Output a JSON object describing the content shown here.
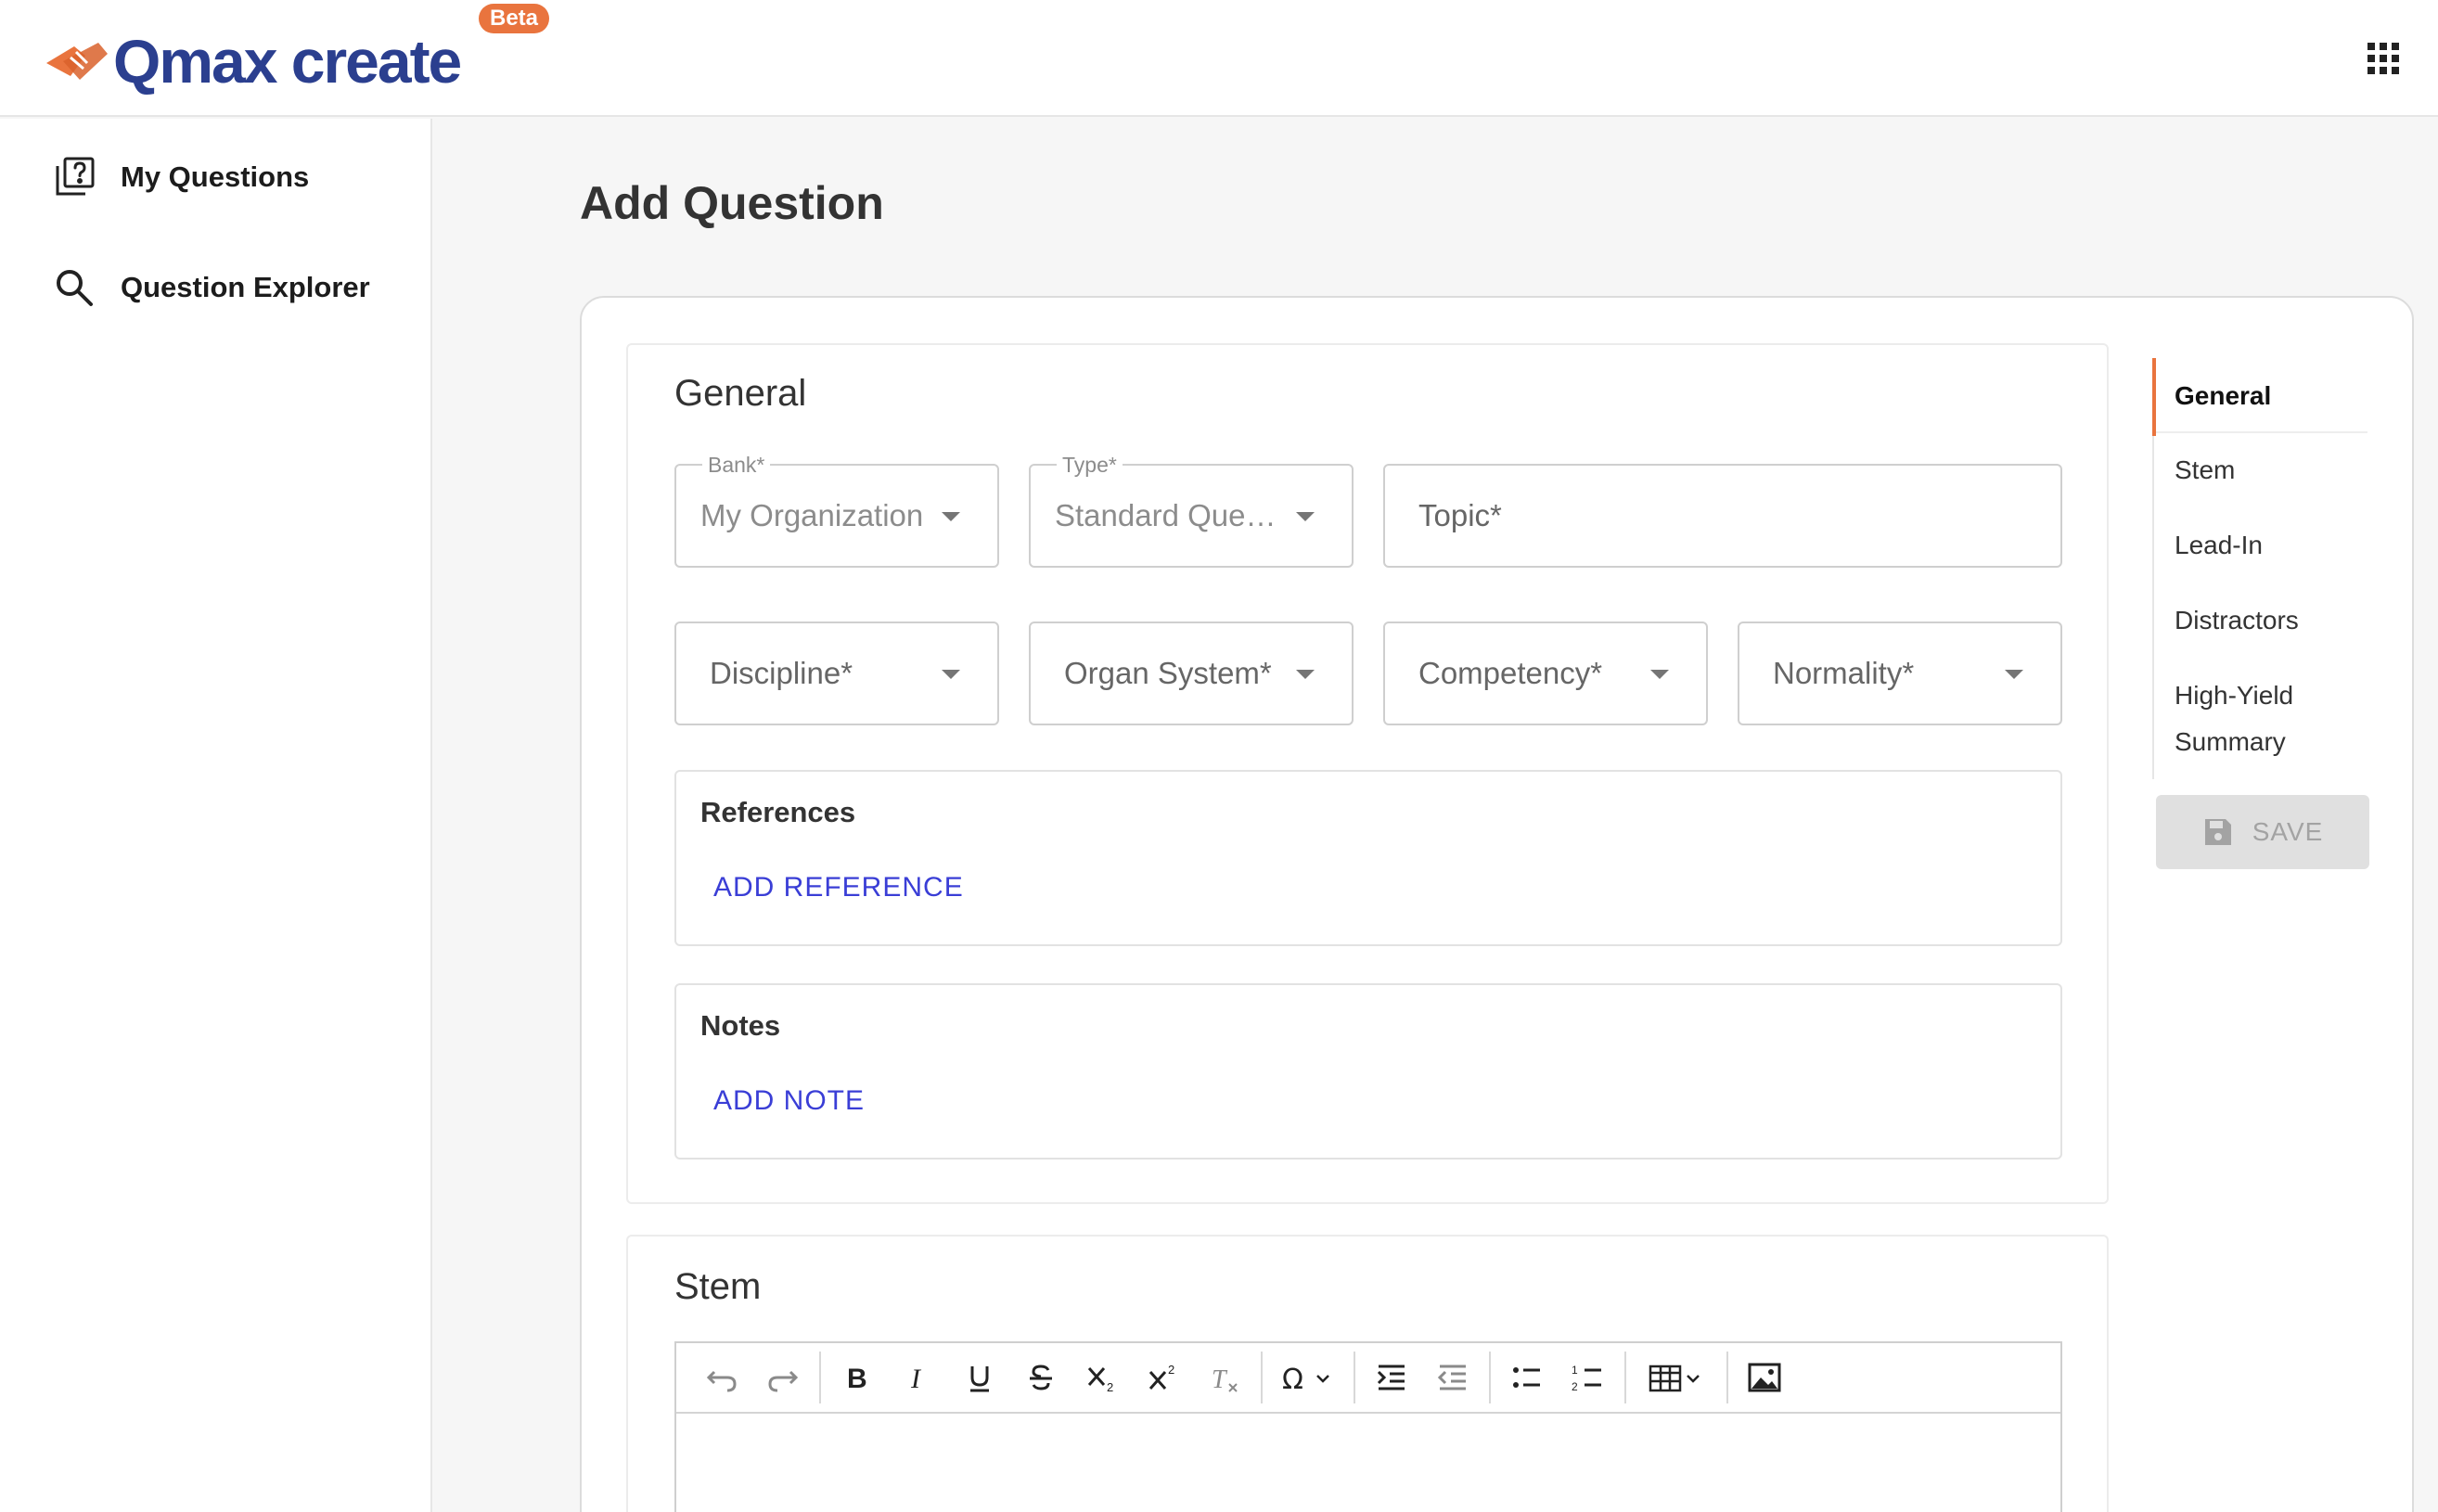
{
  "app": {
    "logo_text": "Qmax create",
    "beta_label": "Beta"
  },
  "sidebar": {
    "items": [
      {
        "label": "My Questions",
        "icon": "question-pages-icon"
      },
      {
        "label": "Question Explorer",
        "icon": "search-icon"
      }
    ]
  },
  "page": {
    "title": "Add Question"
  },
  "general": {
    "title": "General",
    "bank": {
      "label": "Bank*",
      "value": "My Organization"
    },
    "type": {
      "label": "Type*",
      "value": "Standard Que…"
    },
    "topic": {
      "placeholder": "Topic*"
    },
    "discipline": {
      "placeholder": "Discipline*"
    },
    "organ_system": {
      "placeholder": "Organ System*"
    },
    "competency": {
      "placeholder": "Competency*"
    },
    "normality": {
      "placeholder": "Normality*"
    },
    "references": {
      "title": "References",
      "action": "ADD REFERENCE"
    },
    "notes": {
      "title": "Notes",
      "action": "ADD NOTE"
    }
  },
  "stem": {
    "title": "Stem",
    "toolbar": [
      "undo-icon",
      "redo-icon",
      "bold-icon",
      "italic-icon",
      "underline-icon",
      "strikethrough-icon",
      "subscript-icon",
      "superscript-icon",
      "clear-format-icon",
      "special-char-icon",
      "indent-icon",
      "outdent-icon",
      "bullet-list-icon",
      "numbered-list-icon",
      "table-icon",
      "image-icon"
    ]
  },
  "toc": {
    "items": [
      "General",
      "Stem",
      "Lead-In",
      "Distractors",
      "High-Yield Summary"
    ],
    "active": "General"
  },
  "actions": {
    "save_label": "SAVE"
  },
  "colors": {
    "accent": "#e9743e",
    "brand": "#2b3f8f",
    "link": "#3a3ed6"
  }
}
